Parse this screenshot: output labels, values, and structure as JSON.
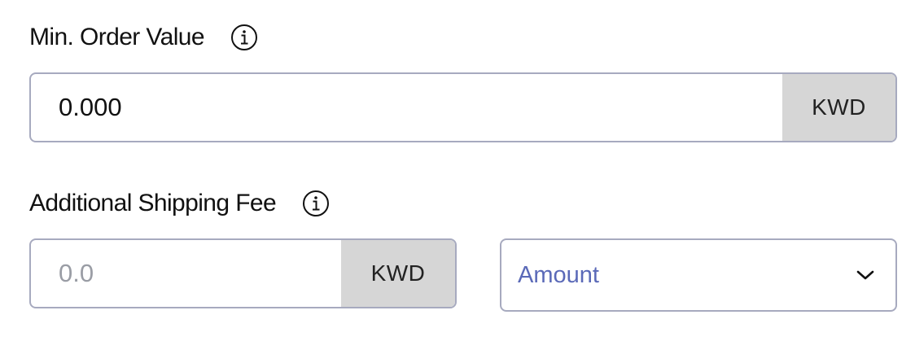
{
  "min_order": {
    "label": "Min. Order Value",
    "info_icon": "info-icon",
    "value": "0.000",
    "placeholder": "",
    "currency": "KWD"
  },
  "shipping_fee": {
    "label": "Additional Shipping Fee",
    "info_icon": "info-icon",
    "value": "",
    "placeholder": "0.0",
    "currency": "KWD"
  },
  "fee_type": {
    "selected": "Amount",
    "icon": "chevron-down-icon"
  },
  "colors": {
    "border": "#a7aabf",
    "addon_bg": "#d6d6d6",
    "select_text": "#5b6ab8",
    "placeholder": "#9a9da5"
  }
}
